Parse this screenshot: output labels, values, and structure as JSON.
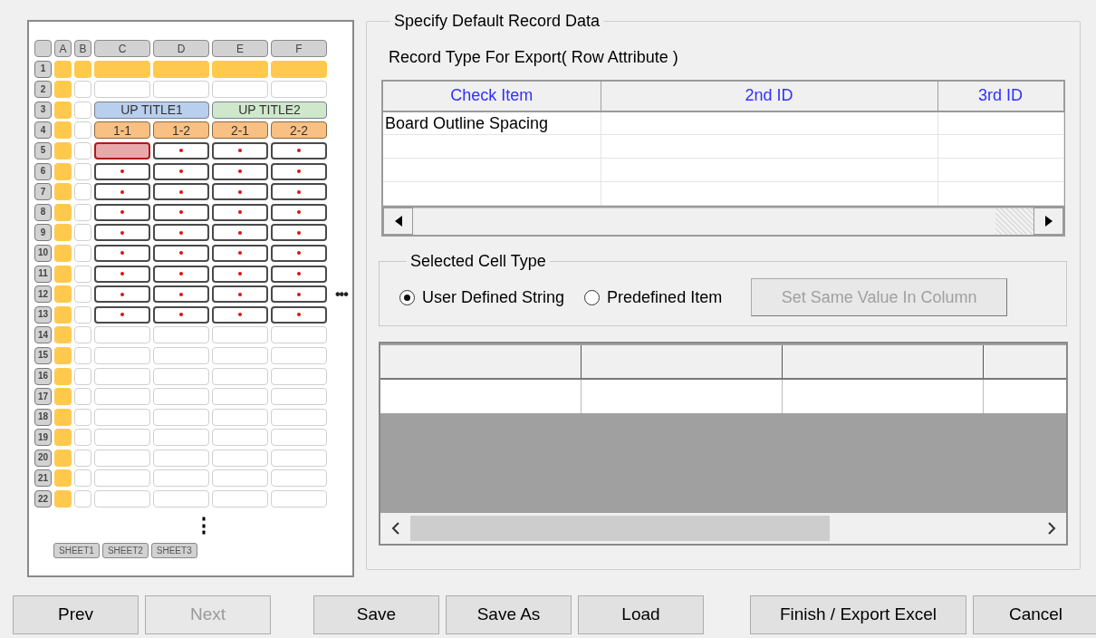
{
  "sheet_preview": {
    "column_headers": [
      "A",
      "B",
      "C",
      "D",
      "E",
      "F"
    ],
    "rows": [
      {
        "label": "1",
        "kind": "title"
      },
      {
        "label": "2",
        "kind": "empty"
      },
      {
        "label": "3",
        "kind": "up_title",
        "titles": [
          {
            "text": "UP TITLE1",
            "color": "#b9cfee"
          },
          {
            "text": "UP TITLE2",
            "color": "#cfe8cc"
          }
        ]
      },
      {
        "label": "4",
        "kind": "sub_title",
        "titles": [
          "1-1",
          "1-2",
          "2-1",
          "2-2"
        ]
      },
      {
        "label": "5",
        "kind": "data",
        "cells": [
          {
            "selected": true
          },
          {
            "selected": false
          },
          {
            "selected": false
          },
          {
            "selected": false
          }
        ]
      },
      {
        "label": "6",
        "kind": "data",
        "cells": [
          {
            "selected": false
          },
          {
            "selected": false
          },
          {
            "selected": false
          },
          {
            "selected": false
          }
        ]
      },
      {
        "label": "7",
        "kind": "data",
        "cells": [
          {
            "selected": false
          },
          {
            "selected": false
          },
          {
            "selected": false
          },
          {
            "selected": false
          }
        ]
      },
      {
        "label": "8",
        "kind": "data",
        "cells": [
          {
            "selected": false
          },
          {
            "selected": false
          },
          {
            "selected": false
          },
          {
            "selected": false
          }
        ]
      },
      {
        "label": "9",
        "kind": "data",
        "cells": [
          {
            "selected": false
          },
          {
            "selected": false
          },
          {
            "selected": false
          },
          {
            "selected": false
          }
        ]
      },
      {
        "label": "10",
        "kind": "data",
        "cells": [
          {
            "selected": false
          },
          {
            "selected": false
          },
          {
            "selected": false
          },
          {
            "selected": false
          }
        ]
      },
      {
        "label": "11",
        "kind": "data",
        "cells": [
          {
            "selected": false
          },
          {
            "selected": false
          },
          {
            "selected": false
          },
          {
            "selected": false
          }
        ]
      },
      {
        "label": "12",
        "kind": "data",
        "cells": [
          {
            "selected": false
          },
          {
            "selected": false
          },
          {
            "selected": false
          },
          {
            "selected": false
          }
        ]
      },
      {
        "label": "13",
        "kind": "data",
        "cells": [
          {
            "selected": false
          },
          {
            "selected": false
          },
          {
            "selected": false
          },
          {
            "selected": false
          }
        ]
      },
      {
        "label": "14",
        "kind": "empty"
      },
      {
        "label": "15",
        "kind": "empty"
      },
      {
        "label": "16",
        "kind": "empty"
      },
      {
        "label": "17",
        "kind": "empty"
      },
      {
        "label": "18",
        "kind": "empty"
      },
      {
        "label": "19",
        "kind": "empty"
      },
      {
        "label": "20",
        "kind": "empty"
      },
      {
        "label": "21",
        "kind": "empty"
      },
      {
        "label": "22",
        "kind": "empty"
      }
    ],
    "more_columns": "•••",
    "more_rows": "⋮",
    "sheets": [
      "SHEET1",
      "SHEET2",
      "SHEET3"
    ]
  },
  "record_group": {
    "title": "Specify Default Record Data",
    "record_type_label": "Record Type For Export( Row Attribute )",
    "record_table": {
      "columns": [
        "Check Item",
        "2nd ID",
        "3rd ID"
      ],
      "rows": [
        {
          "check_item": "Board Outline Spacing"
        }
      ]
    },
    "cell_type_group": {
      "title": "Selected Cell Type",
      "options": [
        {
          "label": "User Defined String",
          "selected": true
        },
        {
          "label": "Predefined Item",
          "selected": false
        }
      ],
      "set_same_button": {
        "label": "Set Same Value In Column",
        "disabled": true
      }
    }
  },
  "button_groups": [
    [
      {
        "label": "Prev",
        "disabled": false
      },
      {
        "label": "Next",
        "disabled": true
      }
    ],
    [
      {
        "label": "Save",
        "disabled": false
      },
      {
        "label": "Save As",
        "disabled": false
      },
      {
        "label": "Load",
        "disabled": false
      }
    ],
    [
      {
        "label": "Finish / Export Excel",
        "disabled": false
      },
      {
        "label": "Cancel",
        "disabled": false
      }
    ]
  ]
}
